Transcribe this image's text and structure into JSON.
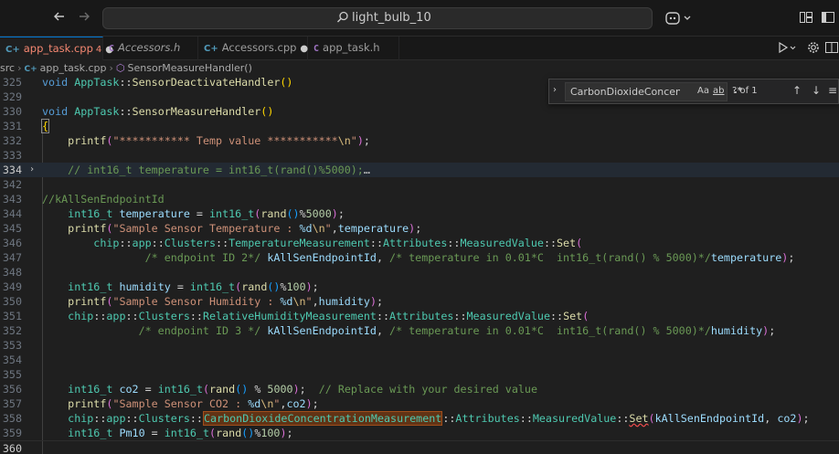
{
  "titlebar": {
    "title": "light_bulb_10"
  },
  "tabs": [
    {
      "label": "app_task.cpp",
      "icon": "cpp-file-icon",
      "modified": true,
      "problems": "4",
      "active": true
    },
    {
      "label": "Accessors.h",
      "icon": "header-file-icon",
      "modified": false,
      "italic": true
    },
    {
      "label": "Accessors.cpp",
      "icon": "cpp-file-icon",
      "modified": true
    },
    {
      "label": "app_task.h",
      "icon": "header-file-icon",
      "modified": false
    }
  ],
  "breadcrumb": [
    "src",
    "app_task.cpp",
    "SensorMeasureHandler()"
  ],
  "find": {
    "value": "CarbonDioxideConcentr",
    "match_case": "Aa",
    "whole_word": "ab",
    "regex": ".*",
    "count": "? of 1"
  },
  "editor": {
    "lines": [
      {
        "n": "325",
        "text": "void AppTask::SensorDeactivateHandler()"
      },
      {
        "n": "329",
        "text": ""
      },
      {
        "n": "330",
        "text": "void AppTask::SensorMeasureHandler()"
      },
      {
        "n": "331",
        "text": "{"
      },
      {
        "n": "332",
        "text": "    printf(\"*********** Temp value ***********\\n\");"
      },
      {
        "n": "333",
        "text": ""
      },
      {
        "n": "334",
        "text": "    // int16_t temperature = int16_t(rand()%5000);…"
      },
      {
        "n": "342",
        "text": ""
      },
      {
        "n": "343",
        "text": "//kAllSenEndpointId"
      },
      {
        "n": "344",
        "text": "    int16_t temperature = int16_t(rand()%5000);"
      },
      {
        "n": "345",
        "text": "    printf(\"Sample Sensor Temperature : %d\\n\",temperature);"
      },
      {
        "n": "346",
        "text": "        chip::app::Clusters::TemperatureMeasurement::Attributes::MeasuredValue::Set("
      },
      {
        "n": "347",
        "text": "                /* endpoint ID 2*/ kAllSenEndpointId, /* temperature in 0.01*C  int16_t(rand() % 5000)*/temperature);"
      },
      {
        "n": "348",
        "text": ""
      },
      {
        "n": "349",
        "text": "    int16_t humidity = int16_t(rand()%100);"
      },
      {
        "n": "350",
        "text": "    printf(\"Sample Sensor Humidity : %d\\n\",humidity);"
      },
      {
        "n": "351",
        "text": "    chip::app::Clusters::RelativeHumidityMeasurement::Attributes::MeasuredValue::Set("
      },
      {
        "n": "352",
        "text": "               /* endpoint ID 3 */ kAllSenEndpointId, /* temperature in 0.01*C  int16_t(rand() % 5000)*/humidity);"
      },
      {
        "n": "353",
        "text": ""
      },
      {
        "n": "354",
        "text": ""
      },
      {
        "n": "355",
        "text": ""
      },
      {
        "n": "356",
        "text": "    int16_t co2 = int16_t(rand() % 5000);  // Replace with your desired value"
      },
      {
        "n": "357",
        "text": "    printf(\"Sample Sensor CO2 : %d\\n\",co2);"
      },
      {
        "n": "358",
        "text": "    chip::app::Clusters::CarbonDioxideConcentrationMeasurement::Attributes::MeasuredValue::Set(kAllSenEndpointId, co2);"
      },
      {
        "n": "359",
        "text": "    int16_t Pm10 = int16_t(rand()%100);"
      },
      {
        "n": "360",
        "text": ""
      }
    ]
  },
  "colors": {
    "accent": "#0078d4",
    "editor_bg": "#1f1f1f",
    "find_match": "#613315"
  }
}
